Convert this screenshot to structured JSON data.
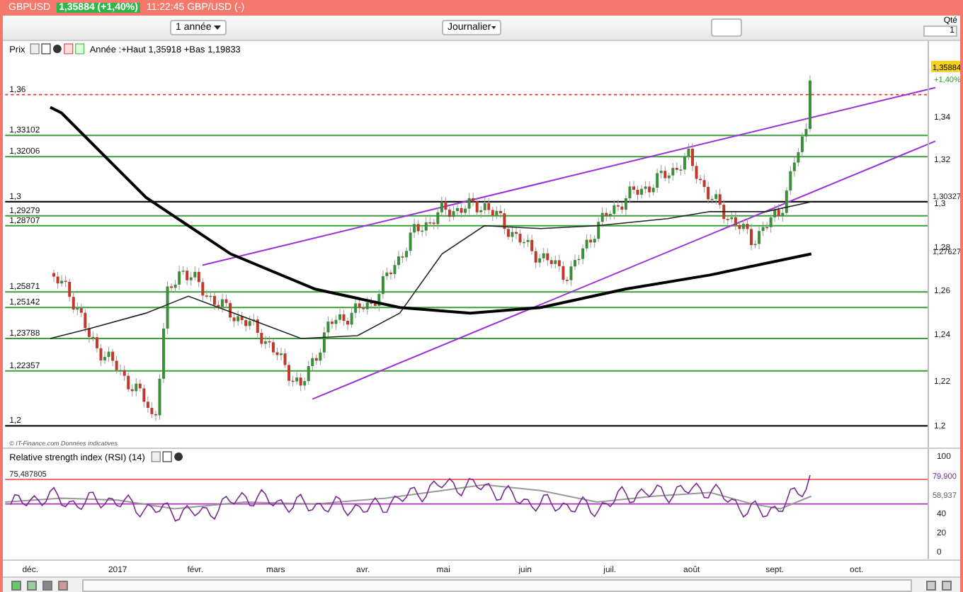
{
  "title_bar": {
    "symbol": "GBPUSD",
    "quote": "1,35884 (+1,40%)",
    "status": "11:22:45 GBP/USD (-)"
  },
  "toolbar": {
    "period": "1 année",
    "interval": "Journalier",
    "quantity_label": "Qté",
    "quantity": "1"
  },
  "price_pane": {
    "label": "Prix",
    "range_info": "Année :+Haut 1,35918 +Bas 1,19833",
    "levels": [
      {
        "label": "1,36",
        "kind": "reference"
      },
      {
        "label": "1,33102",
        "kind": "support"
      },
      {
        "label": "1,32006",
        "kind": "support"
      },
      {
        "label": "1,3",
        "kind": "round"
      },
      {
        "label": "1,29279",
        "kind": "support"
      },
      {
        "label": "1,28707",
        "kind": "support"
      },
      {
        "label": "1,25871",
        "kind": "support"
      },
      {
        "label": "1,25142",
        "kind": "support"
      },
      {
        "label": "1,23788",
        "kind": "support"
      },
      {
        "label": "1,22357",
        "kind": "support"
      },
      {
        "label": "1,2",
        "kind": "round"
      }
    ],
    "axis_ticks": [
      "1,34",
      "1,32",
      "1,3",
      "1,28",
      "1,26",
      "1,24",
      "1,22",
      "1,2"
    ],
    "last_price": "1,35884",
    "change": "+1,40%",
    "markers": [
      "1,30327",
      "1,27627"
    ],
    "source": "© IT-Finance.com Données indicatives"
  },
  "rsi_pane": {
    "label": "Relative strength index (RSI) (14)",
    "reference": "75,487805",
    "last_value": "79,900",
    "average_value": "58,937",
    "axis_ticks": [
      "100",
      "40",
      "20",
      "0"
    ]
  },
  "x_axis": [
    "déc.",
    "2017",
    "févr.",
    "mars",
    "avr.",
    "mai",
    "juin",
    "juil.",
    "août",
    "sept.",
    "oct."
  ]
}
